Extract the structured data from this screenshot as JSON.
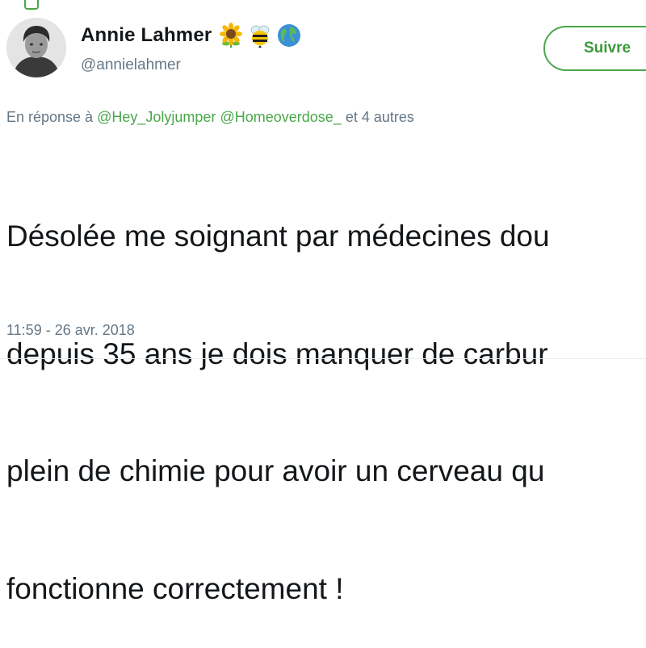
{
  "author": {
    "display_name": "Annie Lahmer",
    "handle": "@annielahmer",
    "emojis": [
      "sunflower-icon",
      "bee-icon",
      "globe-icon"
    ]
  },
  "follow_button": {
    "label": "Suivre"
  },
  "reply": {
    "prefix": "En réponse à",
    "mentions": [
      "@Hey_Jolyjumper",
      "@Homeoverdose_"
    ],
    "suffix": "et 4 autres"
  },
  "tweet": {
    "lines": [
      "Désolée me soignant par médecines dou",
      "depuis 35 ans je dois manquer de carbur",
      "plein de chimie pour avoir un cerveau qu",
      "fonctionne correctement !"
    ],
    "timestamp": "11:59 - 26 avr. 2018"
  },
  "colors": {
    "accent": "#4aa64a",
    "secondary_text": "#657786",
    "primary_text": "#14171a"
  }
}
